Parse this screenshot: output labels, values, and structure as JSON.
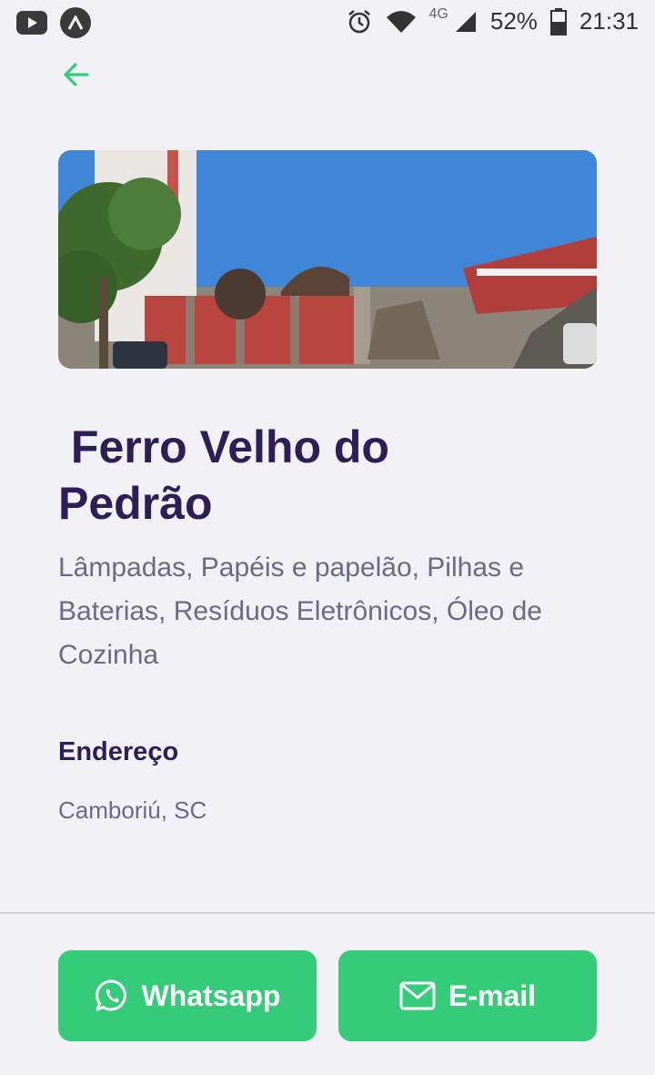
{
  "status_bar": {
    "battery": "52%",
    "network": "4G",
    "time": "21:31"
  },
  "place": {
    "title": " Ferro Velho do\nPedrão",
    "materials": "Lâmpadas, Papéis e papelão, Pilhas e Baterias, Resíduos Eletrônicos, Óleo de Cozinha"
  },
  "address": {
    "label": "Endereço",
    "value": "Camboriú, SC"
  },
  "actions": {
    "whatsapp_label": "Whatsapp",
    "email_label": "E-mail"
  },
  "colors": {
    "accent_green": "#34cb79",
    "title_purple": "#2d1f55",
    "text_gray": "#6b6b80",
    "background": "#f0f0f5"
  },
  "icons": [
    "youtube-icon",
    "app-a-icon",
    "alarm-icon",
    "wifi-icon",
    "signal-icon",
    "battery-icon",
    "back-arrow-icon",
    "whatsapp-icon",
    "mail-icon"
  ]
}
